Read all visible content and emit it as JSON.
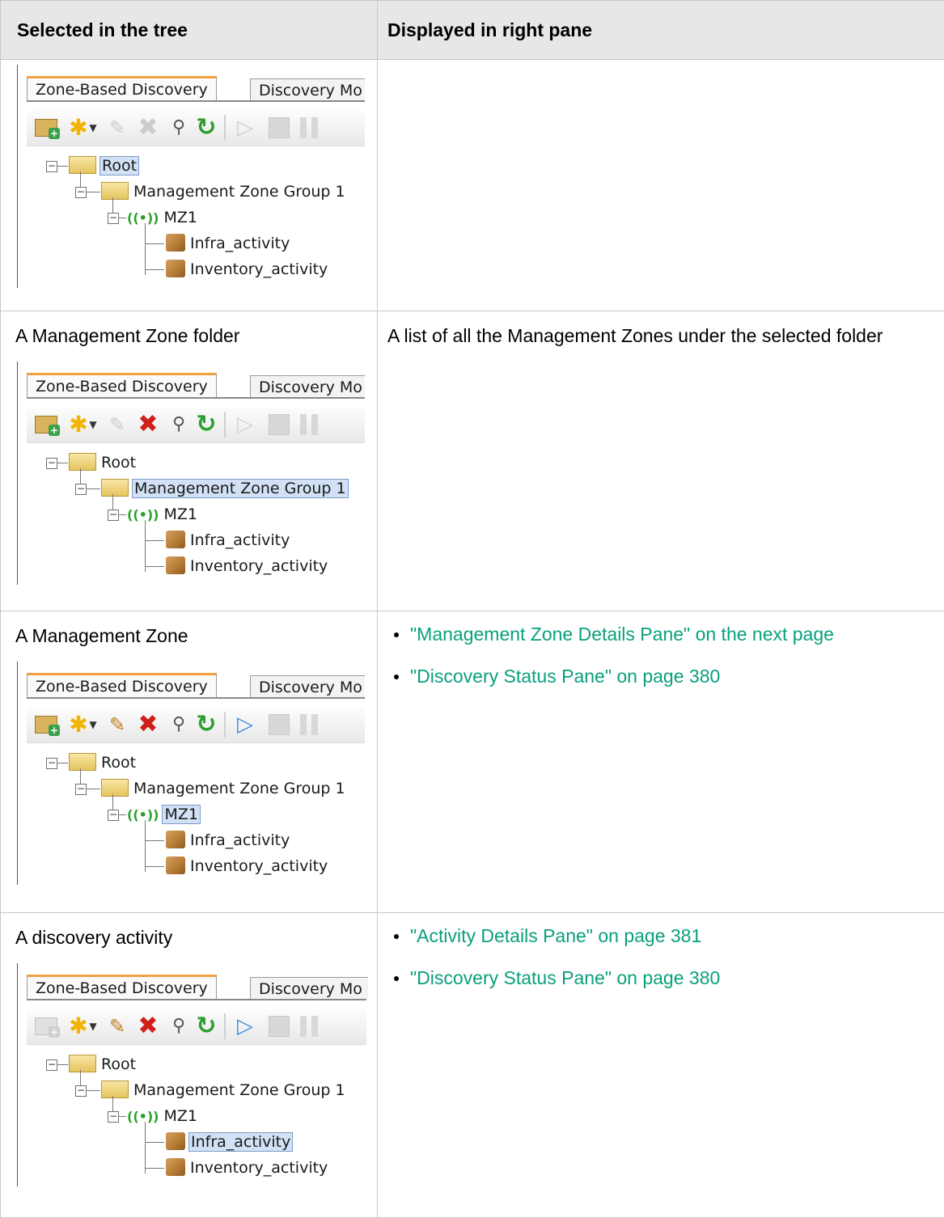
{
  "table": {
    "header": {
      "col1": "Selected in the tree",
      "col2": "Displayed in right pane"
    },
    "rows": [
      {
        "selected_text": "",
        "displayed_text": "",
        "links": [],
        "selected_node": "root"
      },
      {
        "selected_text": "A Management Zone folder",
        "displayed_text": "A list of all the Management Zones under the selected folder",
        "links": [],
        "selected_node": "group"
      },
      {
        "selected_text": "A Management Zone",
        "displayed_text": "",
        "links": [
          "\"Management Zone Details Pane\" on the next page",
          "\"Discovery Status Pane\" on page 380"
        ],
        "selected_node": "mz1"
      },
      {
        "selected_text": "A discovery activity",
        "displayed_text": "",
        "links": [
          "\"Activity Details Pane\" on page 381",
          "\"Discovery Status Pane\" on page 380"
        ],
        "selected_node": "infra"
      }
    ]
  },
  "shot": {
    "tab_active": "Zone-Based Discovery",
    "tab_other": "Discovery Mo",
    "tree": {
      "root": "Root",
      "group": "Management Zone Group 1",
      "mz": "MZ1",
      "activity1": "Infra_activity",
      "activity2": "Inventory_activity"
    },
    "icons": [
      "new-folder-icon",
      "new-star-icon",
      "dropdown-arrow-icon",
      "edit-pencil-icon",
      "delete-x-icon",
      "search-icon",
      "refresh-icon",
      "play-icon",
      "stop-icon",
      "pause-icon"
    ]
  },
  "colors": {
    "link": "#0aa07e",
    "header_bg": "#e7e7e7",
    "selection": "#d2e1f5"
  }
}
